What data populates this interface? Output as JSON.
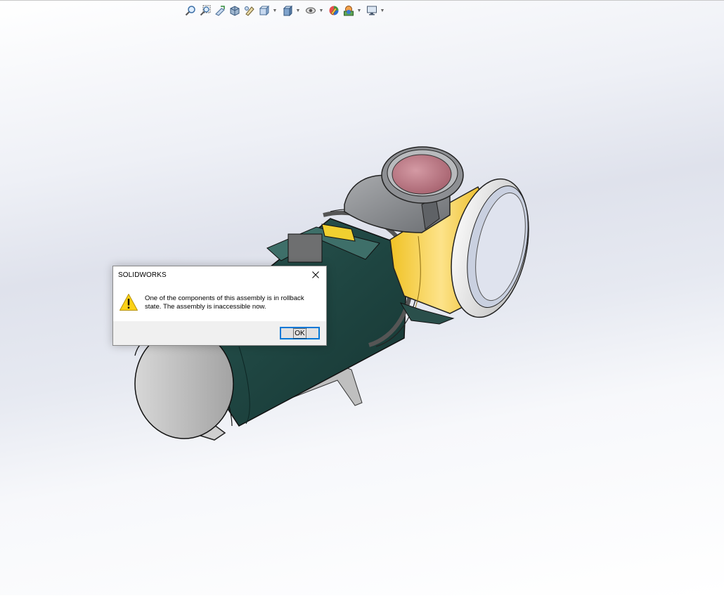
{
  "viewport": {
    "toolbar": {
      "icons": [
        "zoom-to-fit-icon",
        "zoom-to-area-icon",
        "previous-view-icon",
        "section-view-icon",
        "dynamic-annotation-icon",
        "view-orientation-icon",
        "display-style-icon",
        "hide-show-items-icon",
        "edit-appearance-icon",
        "apply-scene-icon",
        "view-settings-icon"
      ]
    }
  },
  "dialog": {
    "title": "SOLIDWORKS",
    "message": "One of the components of this assembly is in rollback state. The assembly is inaccessible now.",
    "ok_label": "OK",
    "icon": "warning-icon",
    "accent_color": "#0078d7"
  }
}
